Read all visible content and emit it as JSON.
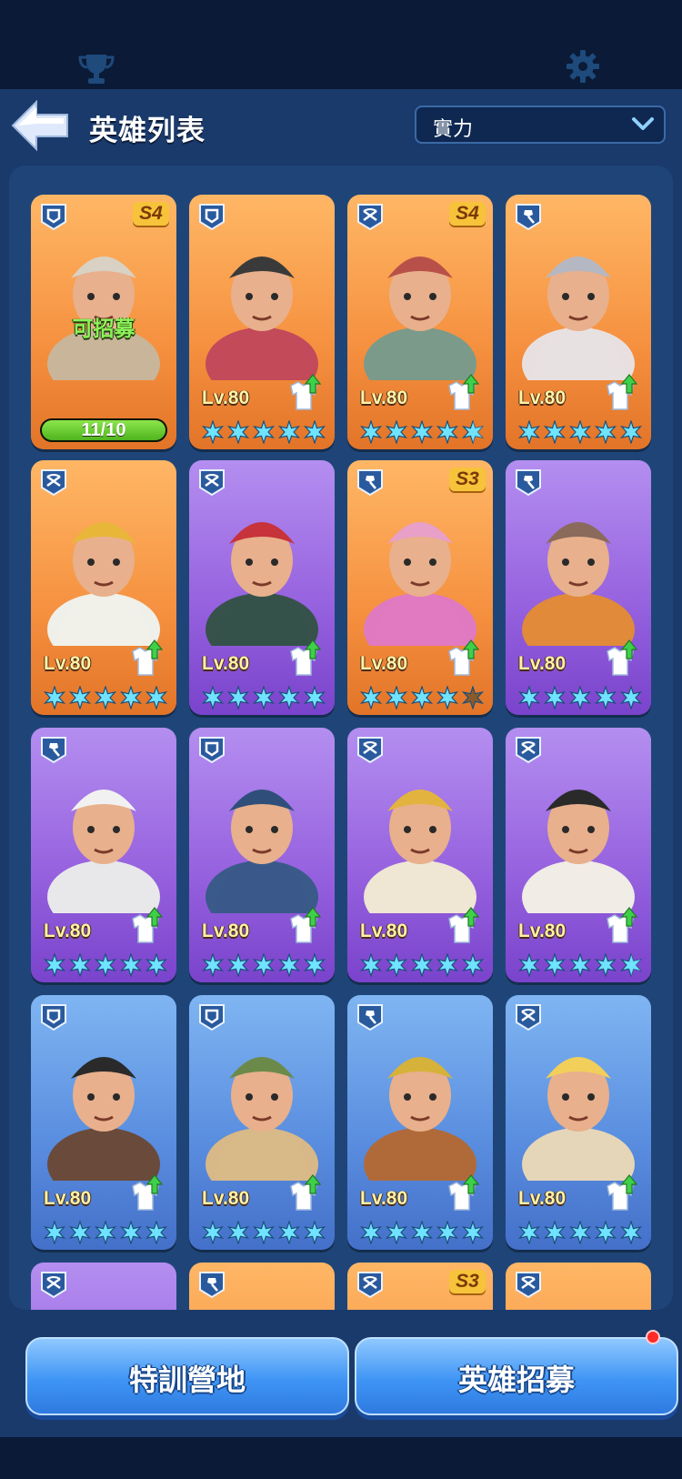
{
  "header": {
    "title": "英雄列表",
    "sort_label": "實力",
    "icons": [
      "trophy-icon",
      "gear-icon",
      "back-arrow-icon",
      "chevron-down-icon"
    ]
  },
  "colors": {
    "orange_card": "#f5903f",
    "purple_card": "#9763df",
    "blue_card": "#5b8fe0",
    "star": "#6fe3ff",
    "recruit_text": "#8df25a"
  },
  "heroes": [
    {
      "name": "hooded-scout",
      "role": "shield",
      "season": "S4",
      "rarity": "orange",
      "recruitable": true,
      "recruit_text": "可招募",
      "progress_text": "11/10",
      "progress": 1.0
    },
    {
      "name": "welder-mask-hero",
      "role": "shield",
      "season": "",
      "rarity": "orange",
      "level": "Lv.80",
      "stars": 5,
      "upgrade": true
    },
    {
      "name": "red-beret-girl",
      "role": "crossbow",
      "season": "S4",
      "rarity": "orange",
      "level": "Lv.80",
      "stars": 4.5,
      "upgrade": true
    },
    {
      "name": "goggle-girl",
      "role": "shovel",
      "season": "",
      "rarity": "orange",
      "level": "Lv.80",
      "stars": 5,
      "upgrade": true
    },
    {
      "name": "miner-helmet-man",
      "role": "crossbow",
      "season": "",
      "rarity": "orange",
      "level": "Lv.80",
      "stars": 5,
      "upgrade": true
    },
    {
      "name": "red-hair-woman",
      "role": "crossbow",
      "season": "",
      "rarity": "purple",
      "level": "Lv.80",
      "stars": 5,
      "upgrade": true
    },
    {
      "name": "earmuff-woman",
      "role": "shovel",
      "season": "S3",
      "rarity": "orange",
      "level": "Lv.80",
      "stars": 4,
      "upgrade": true
    },
    {
      "name": "viking-goggle-dwarf",
      "role": "shovel",
      "season": "",
      "rarity": "purple",
      "level": "Lv.80",
      "stars": 5,
      "upgrade": true
    },
    {
      "name": "chef-beard",
      "role": "shovel",
      "season": "",
      "rarity": "purple",
      "level": "Lv.80",
      "stars": 5,
      "upgrade": true
    },
    {
      "name": "police-hat-man",
      "role": "shield",
      "season": "",
      "rarity": "purple",
      "level": "Lv.80",
      "stars": 5,
      "upgrade": true
    },
    {
      "name": "aviator-blonde-man",
      "role": "crossbow",
      "season": "",
      "rarity": "purple",
      "level": "Lv.80",
      "stars": 5,
      "upgrade": true
    },
    {
      "name": "scarf-girl",
      "role": "crossbow",
      "season": "",
      "rarity": "purple",
      "level": "Lv.80",
      "stars": 4.5,
      "upgrade": true
    },
    {
      "name": "goggle-beard",
      "role": "shield",
      "season": "",
      "rarity": "blue",
      "level": "Lv.80",
      "stars": 5,
      "upgrade": true
    },
    {
      "name": "fur-hat-beard",
      "role": "shield",
      "season": "",
      "rarity": "blue",
      "level": "Lv.80",
      "stars": 5,
      "upgrade": true
    },
    {
      "name": "cap-mustache",
      "role": "shovel",
      "season": "",
      "rarity": "blue",
      "level": "Lv.80",
      "stars": 5,
      "upgrade": true
    },
    {
      "name": "blonde-hair-woman",
      "role": "crossbow",
      "season": "",
      "rarity": "blue",
      "level": "Lv.80",
      "stars": 5,
      "upgrade": true
    },
    {
      "name": "partial-1",
      "role": "crossbow",
      "season": "",
      "rarity": "purple",
      "level": "",
      "stars": 0,
      "upgrade": false
    },
    {
      "name": "partial-2",
      "role": "shovel",
      "season": "",
      "rarity": "orange",
      "level": "",
      "stars": 0,
      "upgrade": false
    },
    {
      "name": "partial-3",
      "role": "crossbow",
      "season": "S3",
      "rarity": "orange",
      "level": "",
      "stars": 0,
      "upgrade": false
    },
    {
      "name": "partial-4",
      "role": "crossbow",
      "season": "",
      "rarity": "orange",
      "level": "",
      "stars": 0,
      "upgrade": false
    }
  ],
  "footer": {
    "left_button": "特訓營地",
    "right_button": "英雄招募",
    "right_notification": true
  }
}
